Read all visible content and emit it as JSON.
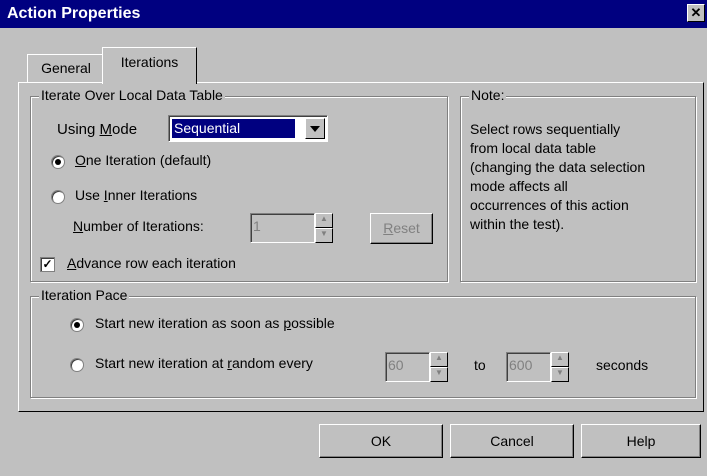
{
  "window": {
    "title": "Action Properties",
    "close_glyph": "✕"
  },
  "tabs": [
    {
      "label": "General",
      "selected": false
    },
    {
      "label": "Iterations",
      "selected": true
    }
  ],
  "iterate_group": {
    "title": "Iterate Over Local Data Table",
    "using_mode_label_pre": "Using ",
    "using_mode_label_key": "M",
    "using_mode_label_post": "ode",
    "using_mode_value": "Sequential",
    "one_iteration": {
      "key": "O",
      "rest": "ne Iteration (default)",
      "checked": true
    },
    "inner_iterations": {
      "pre": "Use ",
      "key": "I",
      "rest": "nner Iterations",
      "checked": false
    },
    "num_iterations": {
      "key": "N",
      "rest": "umber of Iterations:",
      "value": "1"
    },
    "reset": {
      "key": "R",
      "rest": "eset"
    },
    "advance_row": {
      "key": "A",
      "rest": "dvance row each iteration",
      "checked": true
    }
  },
  "note": {
    "title": "Note:",
    "lines": [
      "Select rows sequentially",
      "from local data table",
      "(changing the data selection",
      "mode affects all",
      "occurrences of this action",
      "within the test)."
    ]
  },
  "pace_group": {
    "title": "Iteration Pace",
    "asap": {
      "pre": "Start new iteration as soon as ",
      "key": "p",
      "rest": "ossible",
      "checked": true
    },
    "random": {
      "pre": "Start new iteration at ",
      "key": "r",
      "rest": "andom every",
      "checked": false
    },
    "from_value": "60",
    "to_label": "to",
    "to_value": "600",
    "seconds_label": "seconds"
  },
  "buttons": {
    "ok": "OK",
    "cancel": "Cancel",
    "help": "Help"
  }
}
